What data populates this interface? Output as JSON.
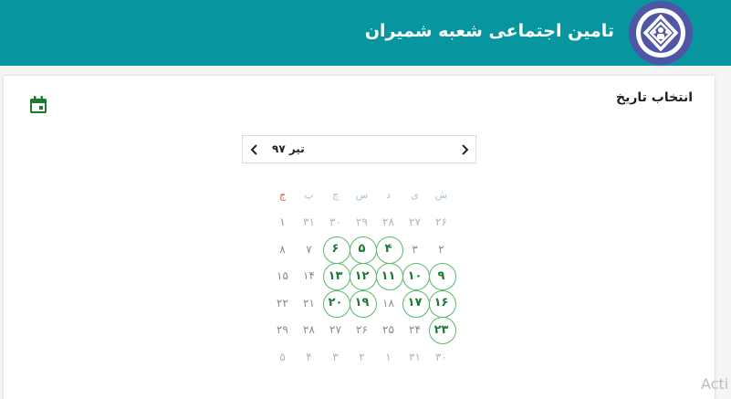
{
  "header": {
    "title": "تامین اجتماعی شعبه شمیران",
    "logo_icon": "social-security-logo-icon",
    "background": "#07969f",
    "logo_color": "#4f56a5"
  },
  "card": {
    "title": "انتخاب تاریخ",
    "calendar_icon": "calendar-icon",
    "icon_color": "#1b7a2e"
  },
  "calendar": {
    "month_label": "تیر ۹۷",
    "prev_icon": "chevron-left-icon",
    "next_icon": "chevron-right-icon",
    "weekdays": [
      "ش",
      "ی",
      "د",
      "س",
      "چ",
      "پ",
      "ج"
    ],
    "weeks": [
      [
        {
          "day": "۲۶",
          "state": "out"
        },
        {
          "day": "۲۷",
          "state": "out"
        },
        {
          "day": "۲۸",
          "state": "out"
        },
        {
          "day": "۲۹",
          "state": "out"
        },
        {
          "day": "۳۰",
          "state": "out"
        },
        {
          "day": "۳۱",
          "state": "out"
        },
        {
          "day": "۱",
          "state": "plain"
        }
      ],
      [
        {
          "day": "۲",
          "state": "plain"
        },
        {
          "day": "۳",
          "state": "plain"
        },
        {
          "day": "۴",
          "state": "avail"
        },
        {
          "day": "۵",
          "state": "avail"
        },
        {
          "day": "۶",
          "state": "avail"
        },
        {
          "day": "۷",
          "state": "plain"
        },
        {
          "day": "۸",
          "state": "plain"
        }
      ],
      [
        {
          "day": "۹",
          "state": "avail"
        },
        {
          "day": "۱۰",
          "state": "avail"
        },
        {
          "day": "۱۱",
          "state": "avail"
        },
        {
          "day": "۱۲",
          "state": "avail"
        },
        {
          "day": "۱۳",
          "state": "avail"
        },
        {
          "day": "۱۴",
          "state": "plain"
        },
        {
          "day": "۱۵",
          "state": "plain"
        }
      ],
      [
        {
          "day": "۱۶",
          "state": "avail"
        },
        {
          "day": "۱۷",
          "state": "avail"
        },
        {
          "day": "۱۸",
          "state": "plain"
        },
        {
          "day": "۱۹",
          "state": "avail"
        },
        {
          "day": "۲۰",
          "state": "avail"
        },
        {
          "day": "۲۱",
          "state": "plain"
        },
        {
          "day": "۲۲",
          "state": "plain"
        }
      ],
      [
        {
          "day": "۲۳",
          "state": "avail"
        },
        {
          "day": "۲۴",
          "state": "plain"
        },
        {
          "day": "۲۵",
          "state": "plain"
        },
        {
          "day": "۲۶",
          "state": "plain"
        },
        {
          "day": "۲۷",
          "state": "plain"
        },
        {
          "day": "۲۸",
          "state": "plain"
        },
        {
          "day": "۲۹",
          "state": "plain"
        }
      ],
      [
        {
          "day": "۳۰",
          "state": "out"
        },
        {
          "day": "۳۱",
          "state": "out"
        },
        {
          "day": "۱",
          "state": "out"
        },
        {
          "day": "۲",
          "state": "out"
        },
        {
          "day": "۳",
          "state": "out"
        },
        {
          "day": "۴",
          "state": "out"
        },
        {
          "day": "۵",
          "state": "out"
        }
      ]
    ],
    "available_color": "#58b96a",
    "friday_color": "#e24b3b"
  },
  "watermark": "Acti"
}
